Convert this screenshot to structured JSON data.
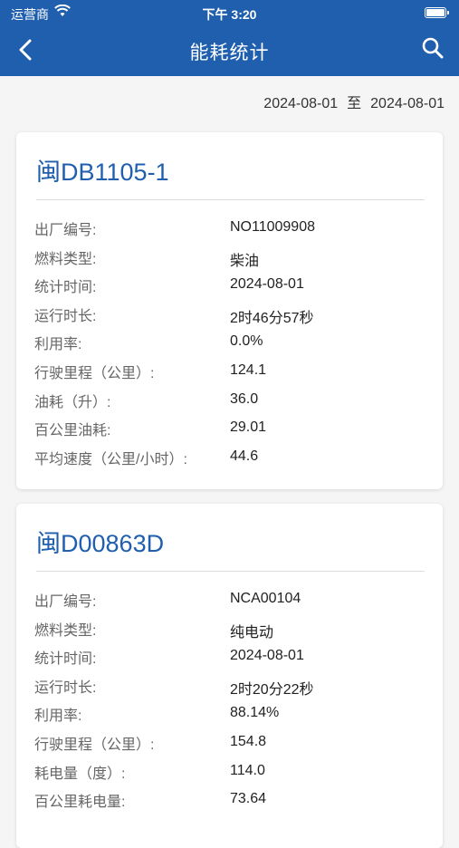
{
  "status_bar": {
    "carrier": "运营商",
    "time": "下午 3:20"
  },
  "navbar": {
    "title": "能耗统计",
    "icons": {
      "back": "chevron-left-icon",
      "search": "search-icon"
    }
  },
  "date_range": {
    "start": "2024-08-01",
    "separator": "至",
    "end": "2024-08-01"
  },
  "colors": {
    "primary": "#1f5fae",
    "background": "#f5f5f5"
  },
  "vehicles": [
    {
      "plate": "闽DB1105-1",
      "fields": [
        {
          "label": "出厂编号:",
          "value": "NO11009908"
        },
        {
          "label": "燃料类型:",
          "value": "柴油"
        },
        {
          "label": "统计时间:",
          "value": "2024-08-01"
        },
        {
          "label": "运行时长:",
          "value": "2时46分57秒"
        },
        {
          "label": "利用率:",
          "value": "0.0%"
        },
        {
          "label": "行驶里程（公里）:",
          "value": "124.1"
        },
        {
          "label": "油耗（升）:",
          "value": "36.0"
        },
        {
          "label": "百公里油耗:",
          "value": "29.01"
        },
        {
          "label": "平均速度（公里/小时）:",
          "value": "44.6"
        }
      ]
    },
    {
      "plate": "闽D00863D",
      "fields": [
        {
          "label": "出厂编号:",
          "value": "NCA00104"
        },
        {
          "label": "燃料类型:",
          "value": "纯电动"
        },
        {
          "label": "统计时间:",
          "value": "2024-08-01"
        },
        {
          "label": "运行时长:",
          "value": "2时20分22秒"
        },
        {
          "label": "利用率:",
          "value": "88.14%"
        },
        {
          "label": "行驶里程（公里）:",
          "value": "154.8"
        },
        {
          "label": "耗电量（度）:",
          "value": "114.0"
        },
        {
          "label": "百公里耗电量:",
          "value": "73.64"
        }
      ]
    }
  ]
}
